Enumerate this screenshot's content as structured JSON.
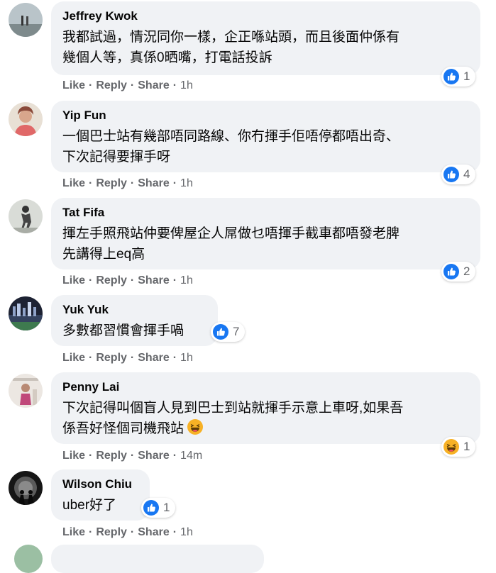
{
  "actions": {
    "like": "Like",
    "reply": "Reply",
    "share": "Share",
    "separator": "·"
  },
  "colors": {
    "bubble": "#f0f2f5",
    "like_blue": "#1877f2",
    "muted": "#65676b"
  },
  "comments": [
    {
      "author": "Jeffrey Kwok",
      "lines": [
        "我都試過，情況同你一樣，企正喺站頭，而且後面仲係有",
        "幾個人等，真係0晒嘴，打電話投訴"
      ],
      "reaction_icon": "like-icon",
      "reaction_count": "1",
      "time": "1h"
    },
    {
      "author": "Yip Fun",
      "lines": [
        "一個巴士站有幾部唔同路線、你冇揮手佢唔停都唔出奇、",
        "下次記得要揮手呀"
      ],
      "reaction_icon": "like-icon",
      "reaction_count": "4",
      "time": "1h"
    },
    {
      "author": "Tat Fifa",
      "lines": [
        "揮左手照飛站仲要俾屋企人屌做乜唔揮手截車都唔發老脾",
        "先講得上eq高"
      ],
      "reaction_icon": "like-icon",
      "reaction_count": "2",
      "time": "1h"
    },
    {
      "author": "Yuk Yuk",
      "lines": [
        "多數都習慣會揮手喎"
      ],
      "reaction_icon": "like-icon",
      "reaction_count": "7",
      "time": "1h"
    },
    {
      "author": "Penny Lai",
      "lines": [
        "下次記得叫個盲人見到巴士到站就揮手示意上車呀,如果吾",
        "係吾好怪個司機飛站"
      ],
      "reaction_icon": "haha-icon",
      "reaction_count": "1",
      "time": "14m"
    },
    {
      "author": "Wilson Chiu",
      "lines": [
        "uber好了"
      ],
      "reaction_icon": "like-icon",
      "reaction_count": "1",
      "time": "1h"
    }
  ]
}
